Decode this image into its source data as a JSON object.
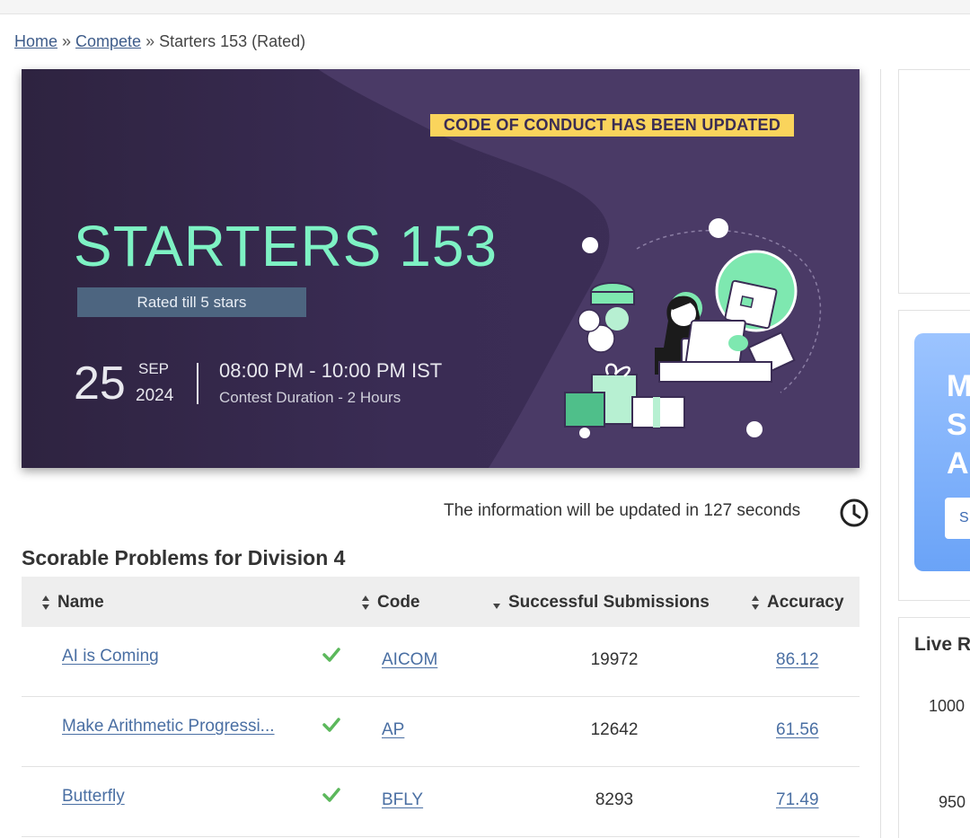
{
  "breadcrumb": {
    "home": "Home",
    "separator": "»",
    "compete": "Compete",
    "current": "Starters 153 (Rated)"
  },
  "banner": {
    "notice": "CODE OF CONDUCT HAS BEEN UPDATED",
    "title": "STARTERS 153",
    "rated": "Rated till 5 stars",
    "day": "25",
    "month": "SEP",
    "year": "2024",
    "time": "08:00 PM - 10:00 PM IST",
    "duration": "Contest Duration - 2 Hours"
  },
  "update_notice": "The information will be updated in 127 seconds",
  "section_title": "Scorable Problems for Division 4",
  "table": {
    "headers": {
      "name": "Name",
      "code": "Code",
      "submissions": "Successful Submissions",
      "accuracy": "Accuracy"
    },
    "rows": [
      {
        "name": "AI is Coming",
        "code": "AICOM",
        "submissions": "19972",
        "accuracy": "86.12"
      },
      {
        "name": "Make Arithmetic Progressi...",
        "code": "AP",
        "submissions": "12642",
        "accuracy": "61.56"
      },
      {
        "name": "Butterfly",
        "code": "BFLY",
        "submissions": "8293",
        "accuracy": "71.49"
      }
    ]
  },
  "sidebar": {
    "promo_lines": [
      "M",
      "S",
      "A"
    ],
    "promo_button": "S",
    "live_title": "Live R",
    "live_values": [
      "1000",
      "950"
    ]
  },
  "colors": {
    "banner_bg": "#3a2c54",
    "title_green": "#7ef2c4",
    "notice_yellow": "#fad45c",
    "link_blue": "#4a6fa3",
    "check_green": "#5cb85c"
  }
}
